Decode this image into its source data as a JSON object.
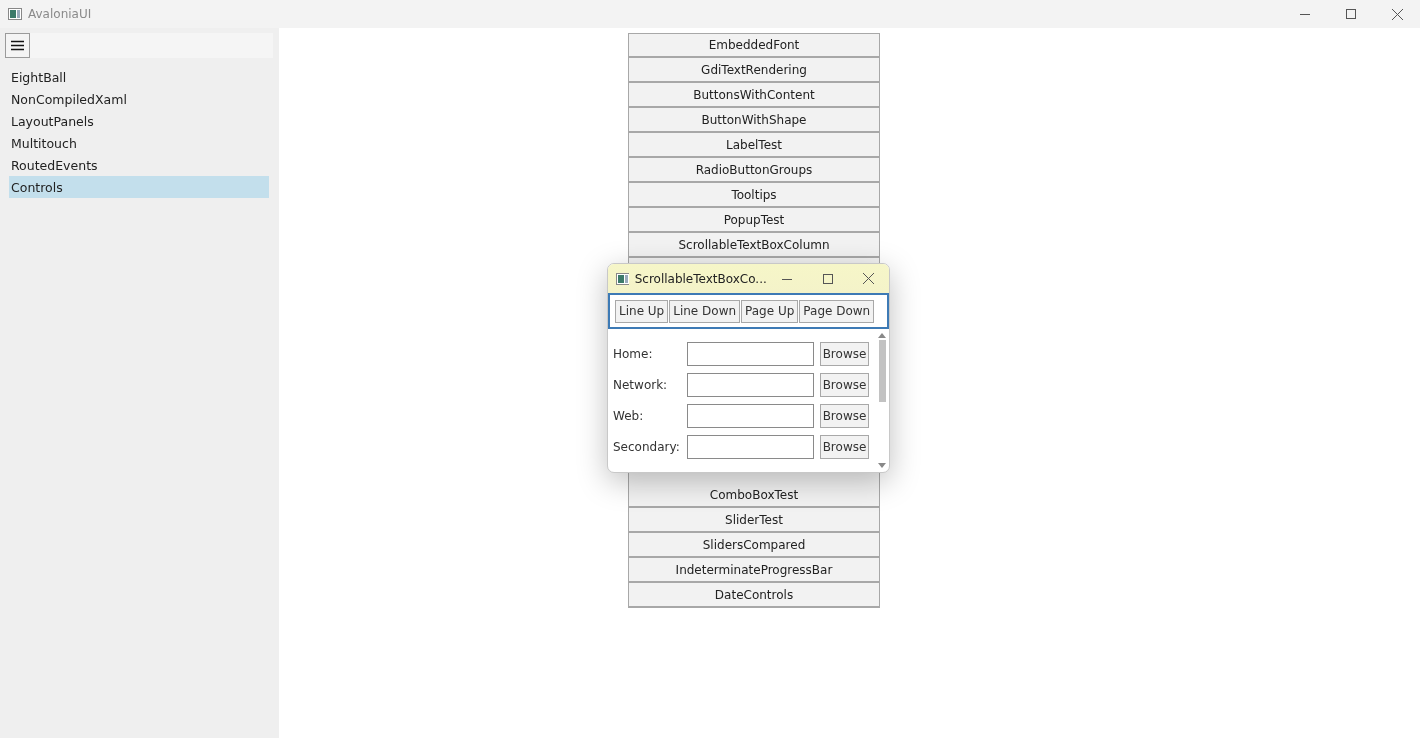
{
  "window": {
    "title": "AvaloniaUI"
  },
  "sidebar": {
    "items": [
      {
        "label": "EightBall",
        "selected": false
      },
      {
        "label": "NonCompiledXaml",
        "selected": false
      },
      {
        "label": "LayoutPanels",
        "selected": false
      },
      {
        "label": "Multitouch",
        "selected": false
      },
      {
        "label": "RoutedEvents",
        "selected": false
      },
      {
        "label": "Controls",
        "selected": true
      }
    ]
  },
  "buttons_top": [
    "EmbeddedFont",
    "GdiTextRendering",
    "ButtonsWithContent",
    "ButtonWithShape",
    "LabelTest",
    "RadioButtonGroups",
    "Tooltips",
    "PopupTest",
    "ScrollableTextBoxColumn"
  ],
  "buttons_bottom": [
    "ComboBoxTest",
    "SliderTest",
    "SlidersCompared",
    "IndeterminateProgressBar",
    "DateControls"
  ],
  "popup": {
    "title": "ScrollableTextBoxCo...",
    "toolbar": [
      "Line Up",
      "Line Down",
      "Page Up",
      "Page Down"
    ],
    "rows": [
      {
        "label": "Home:",
        "button": "Browse"
      },
      {
        "label": "Network:",
        "button": "Browse"
      },
      {
        "label": "Web:",
        "button": "Browse"
      },
      {
        "label": "Secondary:",
        "button": "Browse"
      }
    ]
  }
}
